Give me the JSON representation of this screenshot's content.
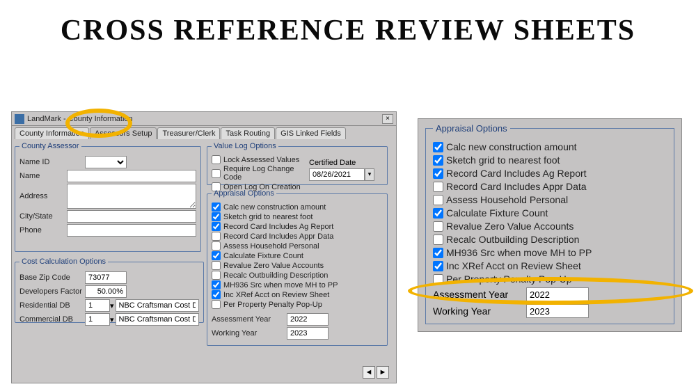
{
  "page_title": "CROSS REFERENCE REVIEW SHEETS",
  "window": {
    "title": "LandMark - County Information",
    "close": "×",
    "tabs": [
      "County Information",
      "Assessors Setup",
      "Treasurer/Clerk",
      "Task Routing",
      "GIS Linked Fields"
    ],
    "active_tab_index": 1
  },
  "assessor": {
    "legend": "County Assessor",
    "labels": {
      "name_id": "Name ID",
      "name": "Name",
      "address": "Address",
      "city_state": "City/State",
      "phone": "Phone"
    },
    "values": {
      "name_id": "",
      "name": "",
      "address": "",
      "city_state": "",
      "phone": ""
    }
  },
  "valuelog": {
    "legend": "Value Log Options",
    "items": [
      {
        "label": "Lock Assessed Values",
        "checked": false
      },
      {
        "label": "Require Log Change Code",
        "checked": false
      },
      {
        "label": "Open Log On Creation",
        "checked": false
      }
    ],
    "certified_label": "Certified Date",
    "certified_date": "08/26/2021"
  },
  "appraisal": {
    "legend": "Appraisal Options",
    "items": [
      {
        "label": "Calc new construction amount",
        "checked": true
      },
      {
        "label": "Sketch grid to nearest foot",
        "checked": true
      },
      {
        "label": "Record Card Includes Ag Report",
        "checked": true
      },
      {
        "label": "Record Card Includes Appr Data",
        "checked": false
      },
      {
        "label": "Assess Household Personal",
        "checked": false
      },
      {
        "label": "Calculate Fixture Count",
        "checked": true
      },
      {
        "label": "Revalue Zero Value Accounts",
        "checked": false
      },
      {
        "label": "Recalc Outbuilding Description",
        "checked": false
      },
      {
        "label": "MH936 Src when move MH to PP",
        "checked": true
      },
      {
        "label": "Inc XRef Acct on Review Sheet",
        "checked": true
      },
      {
        "label": "Per Property Penalty Pop-Up",
        "checked": false
      }
    ],
    "years": {
      "assessment_label": "Assessment Year",
      "assessment_value": "2022",
      "working_label": "Working Year",
      "working_value": "2023"
    }
  },
  "cost": {
    "legend": "Cost Calculation Options",
    "rows": {
      "base_zip_label": "Base Zip Code",
      "base_zip_value": "73077",
      "dev_factor_label": "Developers Factor",
      "dev_factor_value": "50.00%",
      "res_db_label": "Residential DB",
      "res_db_value": "1",
      "res_db_src": "NBC Craftsman Cost Data",
      "com_db_label": "Commercial DB",
      "com_db_value": "1",
      "com_db_src": "NBC Craftsman Cost Data"
    }
  },
  "nav": {
    "prev": "◄",
    "next": "►"
  }
}
